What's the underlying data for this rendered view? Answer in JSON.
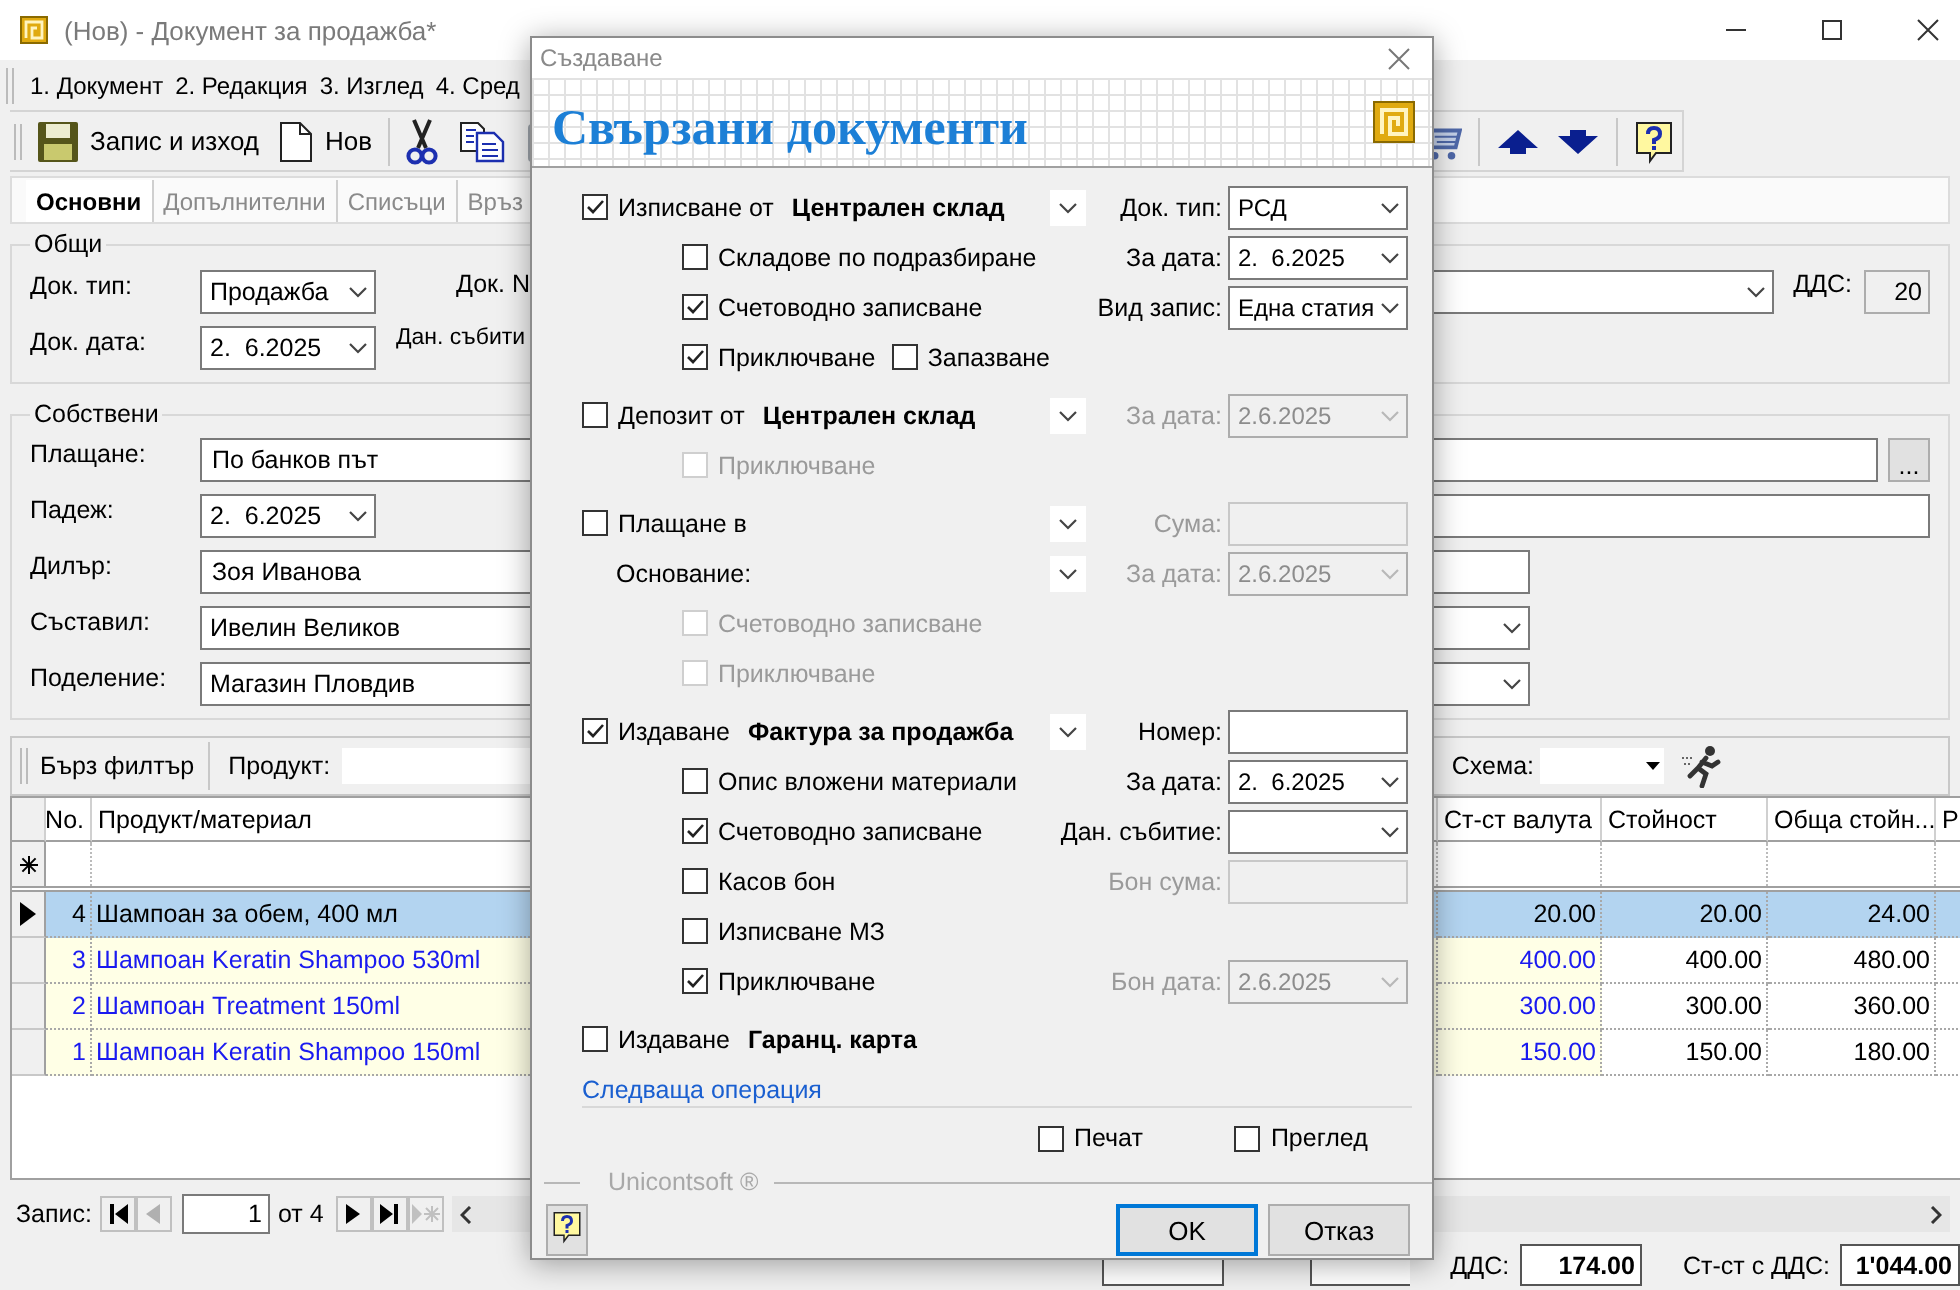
{
  "window": {
    "title": "(Нов) - Документ за продажба*"
  },
  "menu": [
    {
      "label": "1. Документ"
    },
    {
      "label": "2. Редакция"
    },
    {
      "label": "3. Изглед"
    },
    {
      "label": "4. Сред"
    }
  ],
  "toolbar": [
    {
      "kind": "save",
      "label": "Запис и изход",
      "disabled": false
    },
    {
      "kind": "new",
      "label": "Нов",
      "disabled": false
    },
    {
      "kind": "cut",
      "disabled": false
    },
    {
      "kind": "copy",
      "disabled": false
    },
    {
      "kind": "paste",
      "disabled": true
    }
  ],
  "toolbar_right": [
    {
      "kind": "cart",
      "disabled": true
    },
    {
      "kind": "up",
      "disabled": false
    },
    {
      "kind": "down",
      "disabled": false
    },
    {
      "kind": "help",
      "disabled": false
    }
  ],
  "tabs": [
    {
      "label": "Основни",
      "selected": true
    },
    {
      "label": "Допълнителни",
      "selected": false
    },
    {
      "label": "Списъци",
      "selected": false
    },
    {
      "label": "Връз",
      "selected": false
    }
  ],
  "general": {
    "title": "Общи",
    "doc_type_label": "Док. тип:",
    "doc_type": "Продажба",
    "doc_no_label": "Док. N",
    "doc_date_label": "Док. дата:",
    "doc_date": "2.  6.2025",
    "event_label": "Дан. събити",
    "vat_label": "ДДС:",
    "vat": "20"
  },
  "own": {
    "title": "Собствени",
    "rows": [
      {
        "kind": "lookup",
        "label": "Плащане:",
        "value": "По банков път",
        "button": "..."
      },
      {
        "kind": "date",
        "label": "Падеж:",
        "value": "2.  6.2025"
      },
      {
        "kind": "text",
        "label": "Дилър:",
        "value": "Зоя Иванова"
      },
      {
        "kind": "combo",
        "label": "Съставил:",
        "value": "Ивелин Великов"
      },
      {
        "kind": "combo",
        "label": "Поделение:",
        "value": "Магазин Пловдив"
      }
    ]
  },
  "filter": {
    "quick_filter": "Бърз филтър",
    "product_label": "Продукт:",
    "scheme_label": "Схема:"
  },
  "grid": {
    "columns": [
      {
        "label": "No."
      },
      {
        "label": "Продукт/материал"
      },
      {
        "label": "Ст-ст валута"
      },
      {
        "label": "Стойност"
      },
      {
        "label": "Обща стойн..."
      },
      {
        "label": "Р"
      }
    ],
    "rows": [
      {
        "no": "4",
        "product": "Шампоан за обем, 400 мл",
        "currency_value": "20.00",
        "value": "20.00",
        "total": "24.00",
        "selected": true
      },
      {
        "no": "3",
        "product": "Шампоан Keratin Shampoo 530ml",
        "currency_value": "400.00",
        "value": "400.00",
        "total": "480.00",
        "selected": false
      },
      {
        "no": "2",
        "product": "Шампоан Treatment 150ml",
        "currency_value": "300.00",
        "value": "300.00",
        "total": "360.00",
        "selected": false
      },
      {
        "no": "1",
        "product": "Шампоан Keratin Shampoo 150ml",
        "currency_value": "150.00",
        "value": "150.00",
        "total": "180.00",
        "selected": false
      }
    ]
  },
  "navigator": {
    "label": "Запис:",
    "current": "1",
    "total": "от 4"
  },
  "totals": [
    {
      "label": "ДДС:",
      "value": "174.00"
    },
    {
      "label": "Ст-ст с ДДС:",
      "value": "1'044.00"
    }
  ],
  "dialog": {
    "title": "Създаване",
    "heading": "Свързани документи",
    "sections": [
      {
        "rows": [
          {
            "kind": "check",
            "label": "Изписване от",
            "target": "Централен склад",
            "checked": true,
            "disabled": false,
            "dropdown": true,
            "field": {
              "kind": "combo",
              "label": "Док. тип:",
              "value": "РСД",
              "disabled": false
            }
          },
          {
            "kind": "subcheck",
            "label": "Складове по подразбиране",
            "checked": false,
            "disabled": false,
            "dropdown": false,
            "field": {
              "kind": "combo",
              "label": "За дата:",
              "value": "2.  6.2025",
              "disabled": false
            }
          },
          {
            "kind": "subcheck",
            "label": "Счетоводно записване",
            "checked": true,
            "disabled": false,
            "dropdown": false,
            "field": {
              "kind": "combo",
              "label": "Вид запис:",
              "value": "Една статия",
              "disabled": false
            }
          },
          {
            "kind": "subcheck",
            "label": "Приключване",
            "checked": true,
            "disabled": false,
            "dropdown": false,
            "extra": {
              "label": "Запазване",
              "checked": false
            }
          }
        ]
      },
      {
        "rows": [
          {
            "kind": "check",
            "label": "Депозит от",
            "target": "Централен склад",
            "checked": false,
            "disabled": false,
            "dropdown": true,
            "field": {
              "kind": "combo",
              "label": "За дата:",
              "value": "2.6.2025",
              "disabled": true
            }
          },
          {
            "kind": "subcheck",
            "label": "Приключване",
            "checked": false,
            "disabled": true,
            "dropdown": false
          }
        ]
      },
      {
        "rows": [
          {
            "kind": "check",
            "label": "Плащане в",
            "checked": false,
            "disabled": false,
            "dropdown": true,
            "field": {
              "kind": "text",
              "label": "Сума:",
              "disabled": true
            }
          },
          {
            "kind": "label",
            "label": "Основание:",
            "dropdown": true,
            "field": {
              "kind": "combo",
              "label": "За дата:",
              "value": "2.6.2025",
              "disabled": true
            }
          },
          {
            "kind": "subcheck",
            "label": "Счетоводно записване",
            "checked": false,
            "disabled": true,
            "dropdown": false
          },
          {
            "kind": "subcheck",
            "label": "Приключване",
            "checked": false,
            "disabled": true,
            "dropdown": false
          }
        ]
      },
      {
        "rows": [
          {
            "kind": "check",
            "label": "Издаване",
            "target": "Фактура за продажба",
            "checked": true,
            "disabled": false,
            "dropdown": true,
            "field": {
              "kind": "text",
              "label": "Номер:",
              "disabled": false
            }
          },
          {
            "kind": "subcheck",
            "label": "Опис вложени материали",
            "checked": false,
            "disabled": false,
            "dropdown": false,
            "field": {
              "kind": "combo",
              "label": "За дата:",
              "value": "2.  6.2025",
              "disabled": false
            }
          },
          {
            "kind": "subcheck",
            "label": "Счетоводно записване",
            "checked": true,
            "disabled": false,
            "dropdown": false,
            "field": {
              "kind": "combo",
              "label": "Дан. събитие:",
              "disabled": false
            }
          },
          {
            "kind": "subcheck",
            "label": "Касов бон",
            "checked": false,
            "disabled": false,
            "dropdown": false,
            "field": {
              "kind": "text",
              "label": "Бон сума:",
              "disabled": true
            }
          },
          {
            "kind": "subcheck",
            "label": "Изписване МЗ",
            "checked": false,
            "disabled": false,
            "dropdown": false
          },
          {
            "kind": "subcheck",
            "label": "Приключване",
            "checked": true,
            "disabled": false,
            "dropdown": false,
            "field": {
              "kind": "combo",
              "label": "Бон дата:",
              "value": "2.6.2025",
              "disabled": true
            }
          }
        ]
      },
      {
        "rows": [
          {
            "kind": "check",
            "label": "Издаване",
            "target": "Гаранц. карта",
            "checked": false,
            "disabled": false,
            "dropdown": false
          }
        ]
      }
    ],
    "link": "Следваща операция",
    "print_options": [
      {
        "label": "Печат",
        "checked": false
      },
      {
        "label": "Преглед",
        "checked": false
      }
    ],
    "brand": "Unicontsoft ®",
    "buttons": [
      {
        "kind": "help",
        "default": false
      },
      {
        "kind": "ok",
        "label": "OK",
        "default": true
      },
      {
        "kind": "cancel",
        "label": "Отказ",
        "default": false
      }
    ]
  }
}
